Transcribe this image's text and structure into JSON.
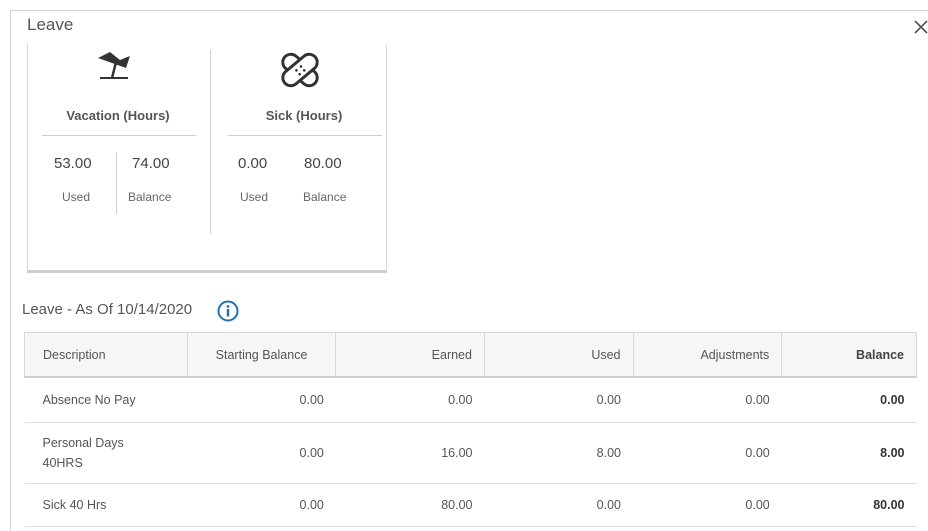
{
  "dialog": {
    "title": "Leave",
    "close_icon": "close-icon"
  },
  "summary": {
    "vacation": {
      "icon": "beach-chair-icon",
      "title": "Vacation (Hours)",
      "used": "53.00",
      "used_label": "Used",
      "balance": "74.00",
      "balance_label": "Balance"
    },
    "sick": {
      "icon": "bandage-icon",
      "title": "Sick (Hours)",
      "used": "0.00",
      "used_label": "Used",
      "balance": "80.00",
      "balance_label": "Balance"
    }
  },
  "section": {
    "title": "Leave - As Of 10/14/2020",
    "info_icon": "info-icon"
  },
  "table": {
    "headers": [
      "Description",
      "Starting Balance",
      "Earned",
      "Used",
      "Adjustments",
      "Balance"
    ],
    "rows": [
      [
        "Absence No Pay",
        "0.00",
        "0.00",
        "0.00",
        "0.00",
        "0.00"
      ],
      [
        "Personal Days 40HRS",
        "0.00",
        "16.00",
        "8.00",
        "0.00",
        "8.00"
      ],
      [
        "Sick 40 Hrs",
        "0.00",
        "80.00",
        "0.00",
        "0.00",
        "80.00"
      ]
    ]
  }
}
